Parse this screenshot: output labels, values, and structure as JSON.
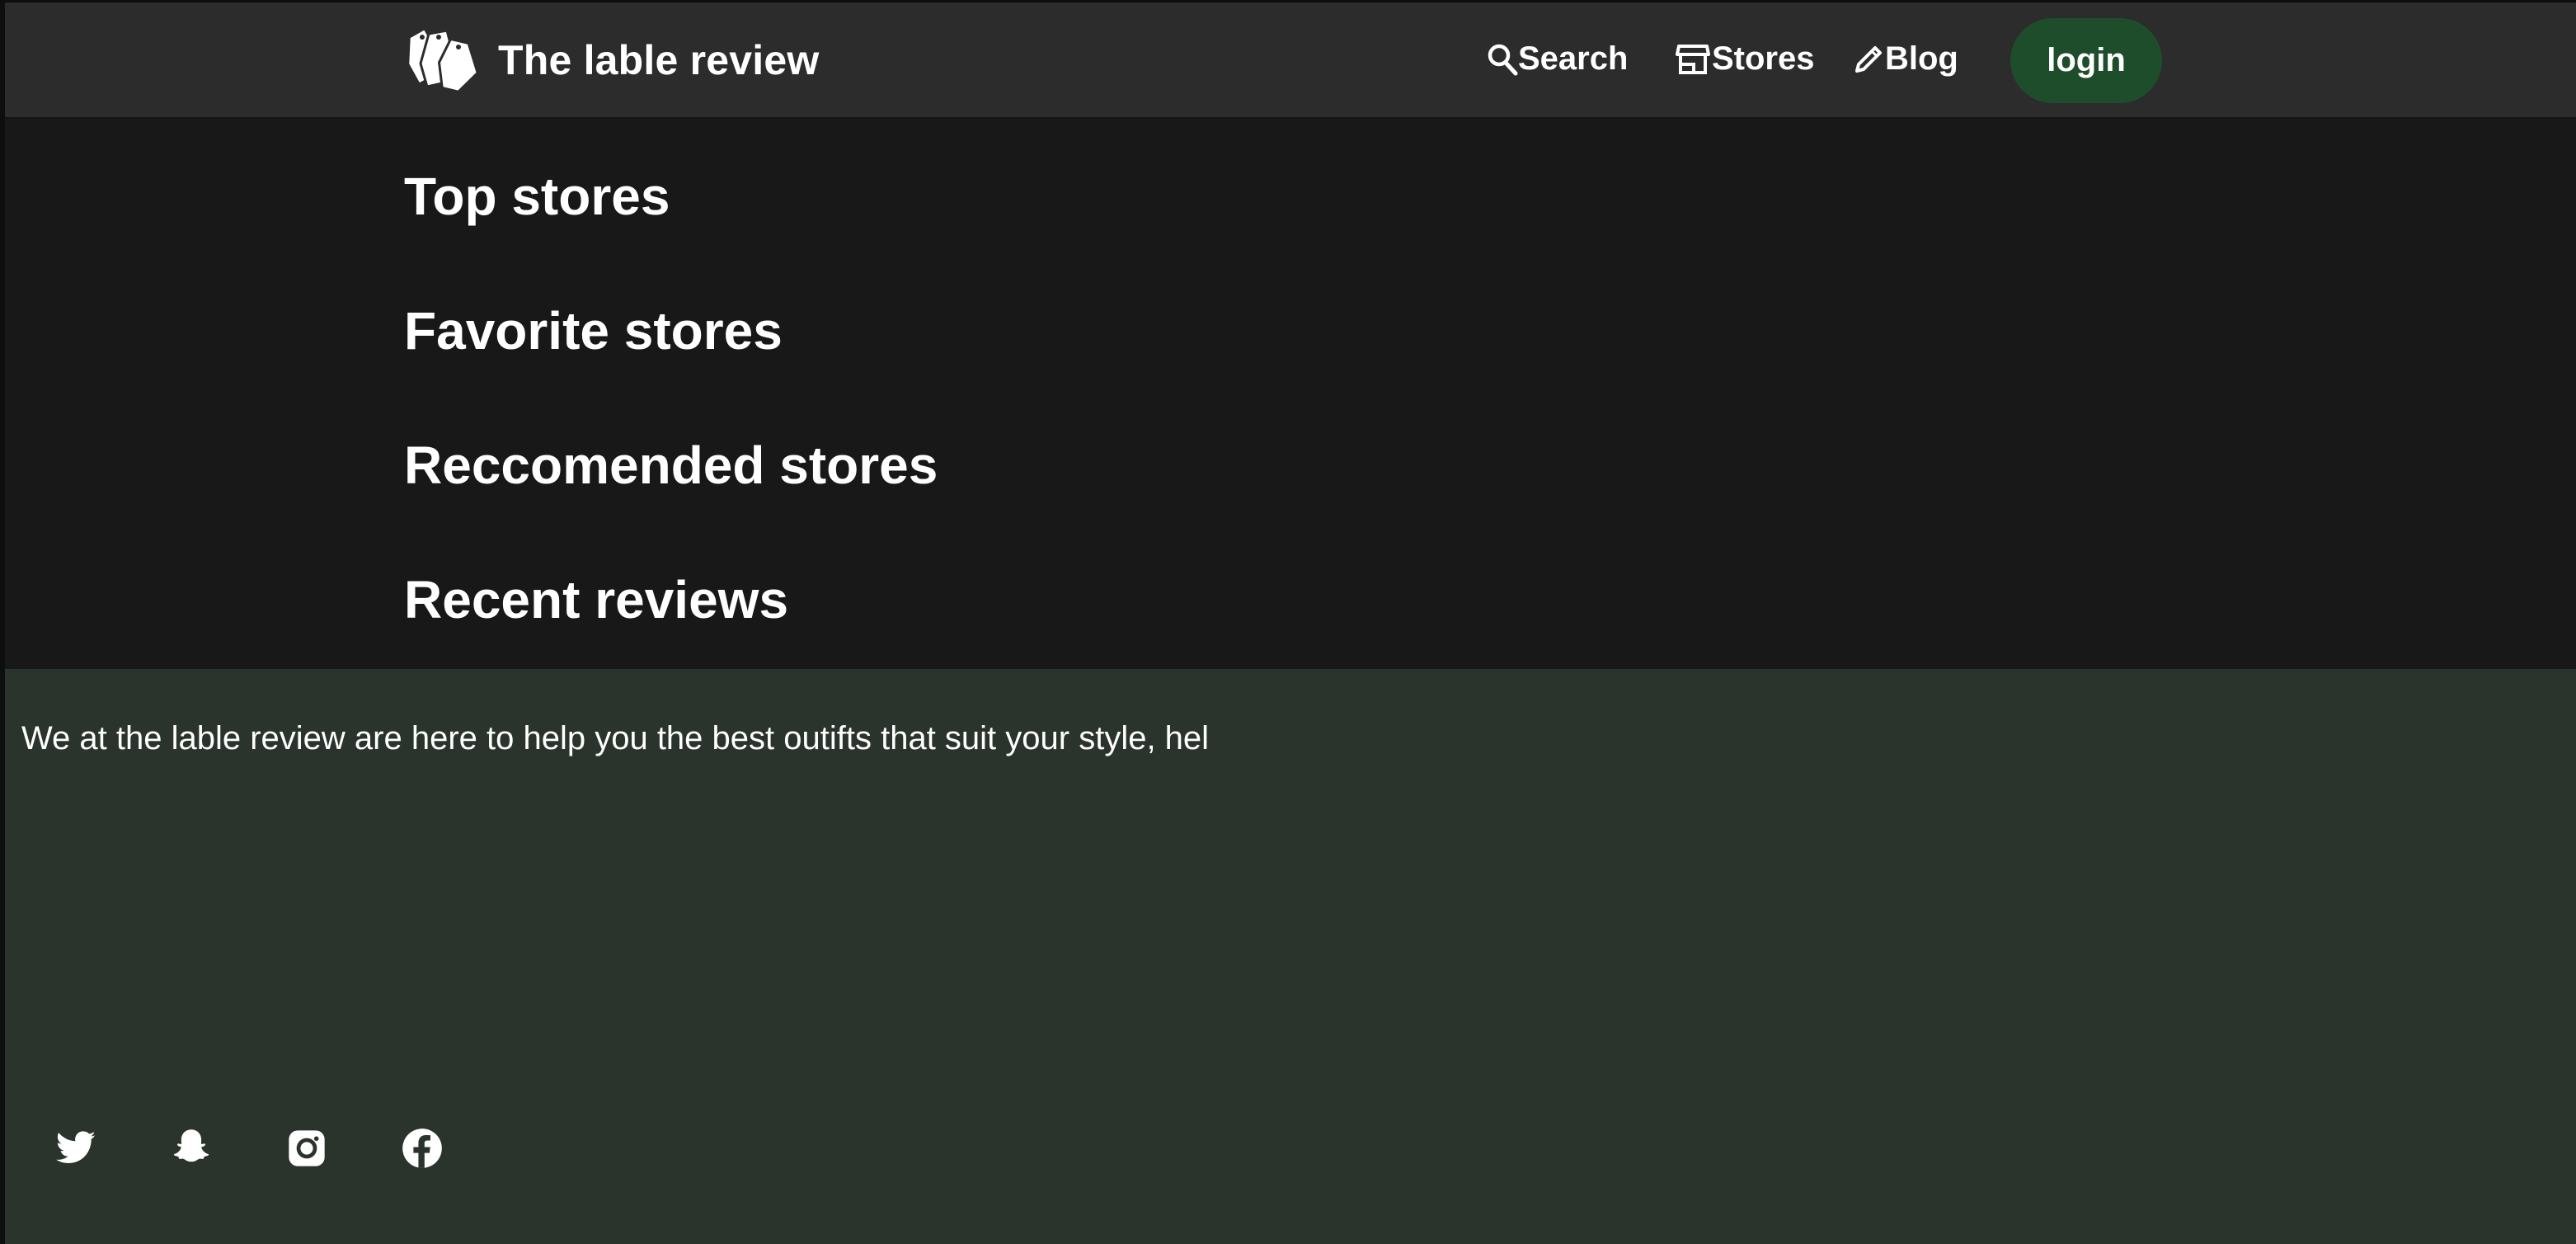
{
  "header": {
    "brand_title": "The lable review",
    "brand_icon": "price-tags-icon",
    "nav": {
      "search": {
        "label": "Search",
        "icon": "search-icon"
      },
      "stores": {
        "label": "Stores",
        "icon": "storefront-icon"
      },
      "blog": {
        "label": "Blog",
        "icon": "pencil-icon"
      }
    },
    "login_label": "login"
  },
  "main": {
    "sections": [
      "Top stores",
      "Favorite stores",
      "Reccomended stores",
      "Recent reviews"
    ]
  },
  "footer": {
    "text": "We at the lable review are here to help you the best outifts that suit your style, hel",
    "social": [
      "twitter-icon",
      "snapchat-icon",
      "instagram-icon",
      "facebook-icon"
    ]
  },
  "colors": {
    "header_bg": "#2c2c2c",
    "page_bg": "#181818",
    "footer_bg": "#2a332c",
    "login_bg": "#1e4d2b",
    "text": "#ffffff"
  }
}
